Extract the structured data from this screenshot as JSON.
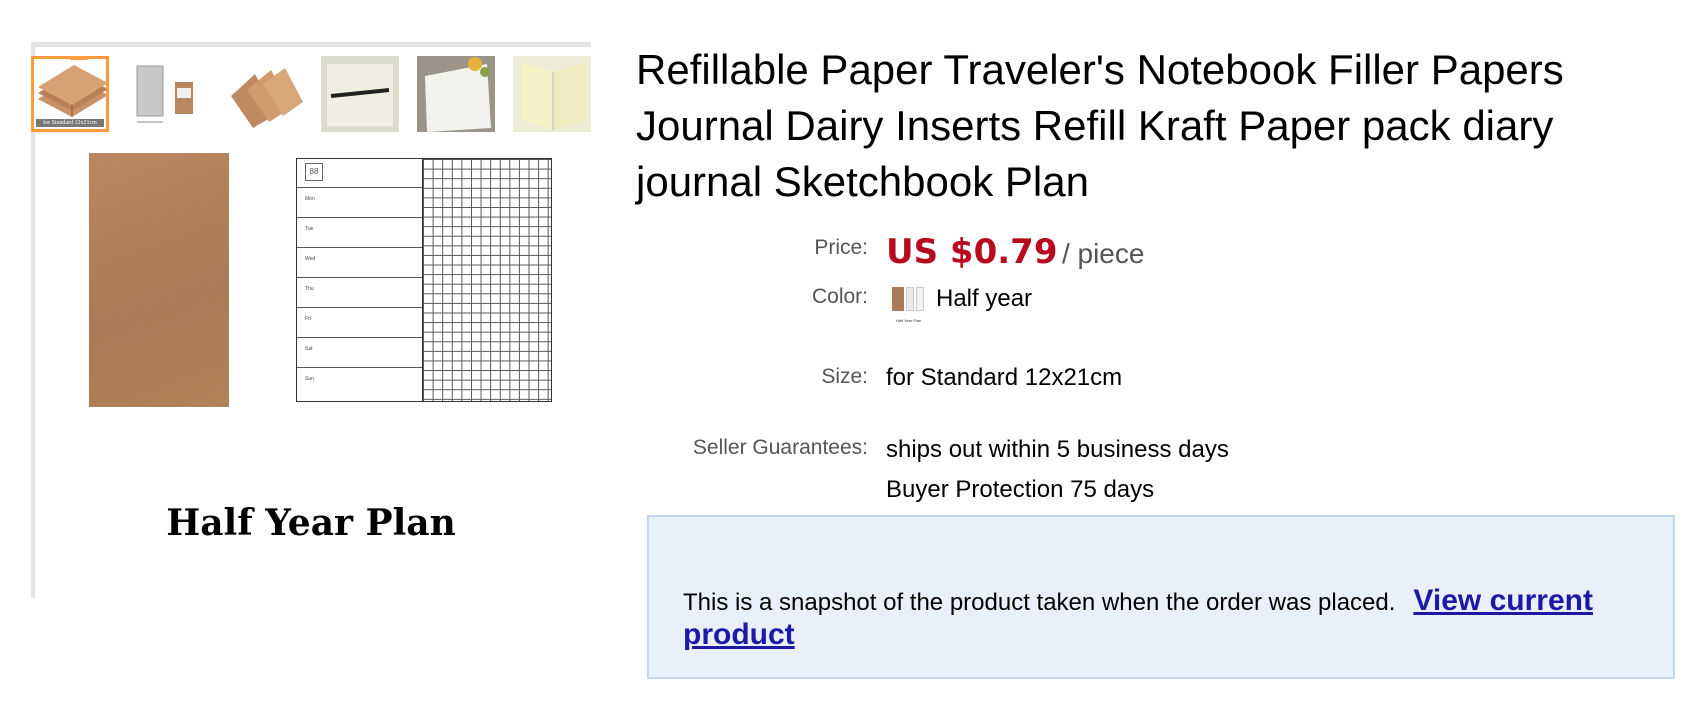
{
  "gallery": {
    "thumbnails": [
      {
        "alt": "kraft notebooks",
        "caption": "for Standard 12x21cm",
        "active": true
      },
      {
        "alt": "size chart",
        "caption": "",
        "active": false
      },
      {
        "alt": "kraft covers",
        "caption": "",
        "active": false
      },
      {
        "alt": "notebook with pen",
        "caption": "",
        "active": false
      },
      {
        "alt": "open notebook flowers",
        "caption": "",
        "active": false
      },
      {
        "alt": "cream pages",
        "caption": "",
        "active": false
      }
    ],
    "plan_caption": "Half Year Plan"
  },
  "product": {
    "title": "Refillable Paper Traveler's Notebook Filler Papers Journal Dairy Inserts Refill Kraft Paper pack diary journal Sketchbook Plan",
    "price_label": "Price:",
    "price_amount": "US $0.79",
    "price_unit": "/ piece",
    "color_label": "Color:",
    "color_value": "Half year",
    "color_swatch_text": "Half Year Plan",
    "size_label": "Size:",
    "size_value": "for Standard 12x21cm",
    "guarantees_label": "Seller Guarantees:",
    "guarantee_1": "ships out within 5 business days",
    "guarantee_2": "Buyer Protection 75 days"
  },
  "snapshot": {
    "message": "This is a snapshot of the product taken when the order was placed.",
    "link_text": "View current product"
  },
  "colors": {
    "price": "#b80a1f",
    "link": "#1a1aa6",
    "snapshot_bg": "#e9f0fb",
    "thumb_active": "#ff9a3c"
  }
}
